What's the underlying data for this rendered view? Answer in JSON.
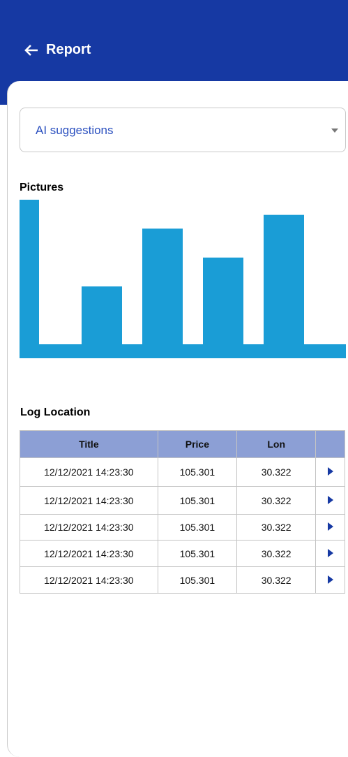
{
  "header": {
    "title": "Report",
    "back_icon": "arrow-left-icon",
    "bg_color": "#1639a3"
  },
  "suggestions": {
    "selected": "AI suggestions",
    "caret_icon": "caret-down-icon"
  },
  "pictures": {
    "title": "Pictures"
  },
  "chart_data": {
    "type": "bar",
    "title": "",
    "xlabel": "",
    "ylabel": "",
    "categories": [
      "",
      "",
      "",
      ""
    ],
    "values": [
      42,
      84,
      63,
      94
    ],
    "ylim": [
      0,
      105
    ],
    "bar_color": "#1a9dd6",
    "axis_color": "#1a9dd6",
    "grid": false
  },
  "log": {
    "title": "Log Location",
    "columns": [
      "Title",
      "Price",
      "Lon",
      ""
    ],
    "rows": [
      {
        "title": "12/12/2021 14:23:30",
        "price": "105.301",
        "lon": "30.322"
      },
      {
        "title": "12/12/2021 14:23:30",
        "price": "105.301",
        "lon": "30.322"
      },
      {
        "title": "12/12/2021 14:23:30",
        "price": "105.301",
        "lon": "30.322"
      },
      {
        "title": "12/12/2021 14:23:30",
        "price": "105.301",
        "lon": "30.322"
      },
      {
        "title": "12/12/2021 14:23:30",
        "price": "105.301",
        "lon": "30.322"
      }
    ],
    "row_icon": "caret-right-icon",
    "header_color": "#8c9fd5"
  }
}
